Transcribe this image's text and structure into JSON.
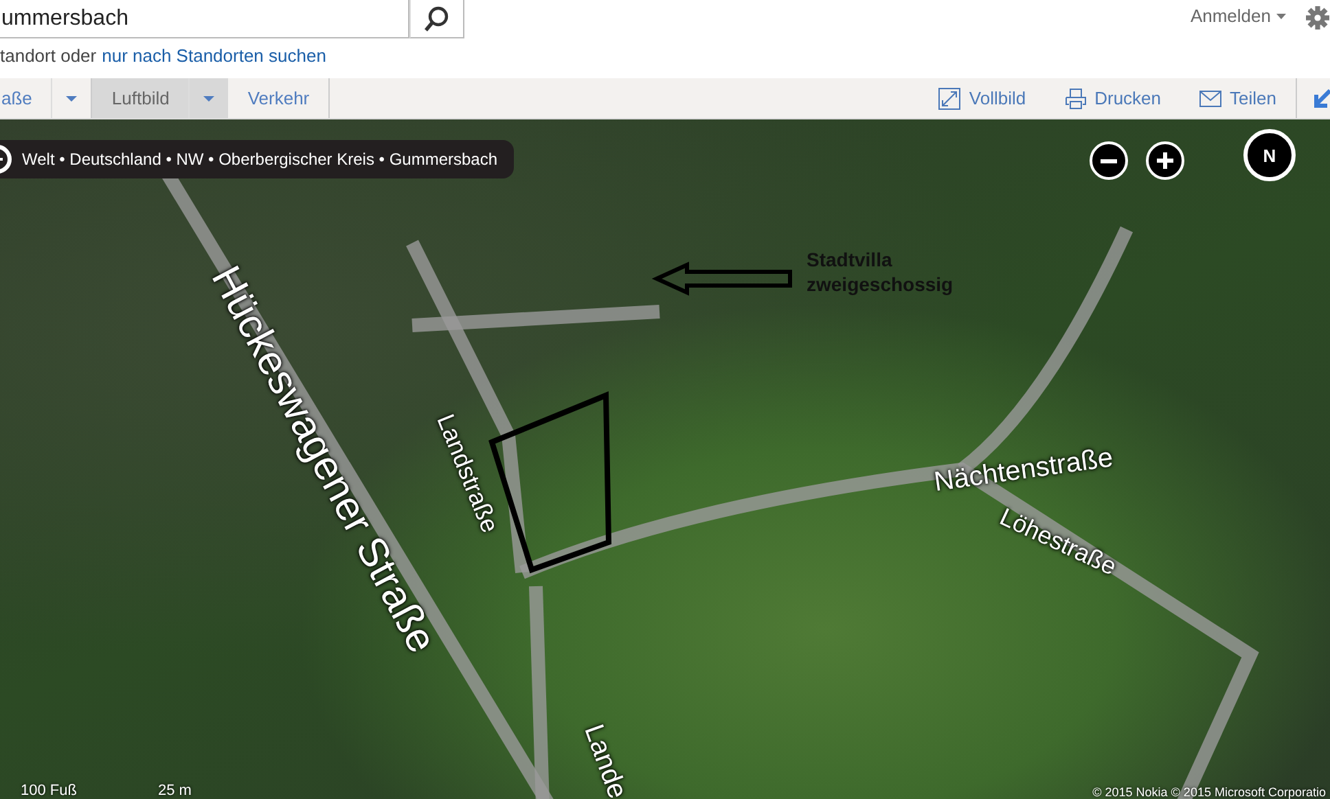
{
  "search": {
    "value": "ummersbach"
  },
  "account": {
    "label": "Anmelden"
  },
  "hint": {
    "text": "tandort oder",
    "link": "nur nach Standorten suchen"
  },
  "map_types": [
    {
      "label": "aße",
      "selected": false,
      "dropdown": true
    },
    {
      "label": "Luftbild",
      "selected": true,
      "dropdown": true
    },
    {
      "label": "Verkehr",
      "selected": false,
      "dropdown": false
    }
  ],
  "actions": [
    {
      "label": "Vollbild",
      "kind": "fullscreen"
    },
    {
      "label": "Drucken",
      "kind": "print"
    },
    {
      "label": "Teilen",
      "kind": "share"
    }
  ],
  "breadcrumb": "Welt • Deutschland • NW • Oberbergischer Kreis • Gummersbach",
  "compass": {
    "label": "N"
  },
  "streets": [
    "Hückeswagener Straße",
    "Landstraße",
    "Nächtenstraße",
    "Löhestraße",
    "Lande"
  ],
  "annotation": [
    "Stadtvilla",
    "zweigeschossig"
  ],
  "scale": [
    "100 Fuß",
    "25 m"
  ],
  "copyright": "© 2015 Nokia   © 2015 Microsoft Corporatio"
}
